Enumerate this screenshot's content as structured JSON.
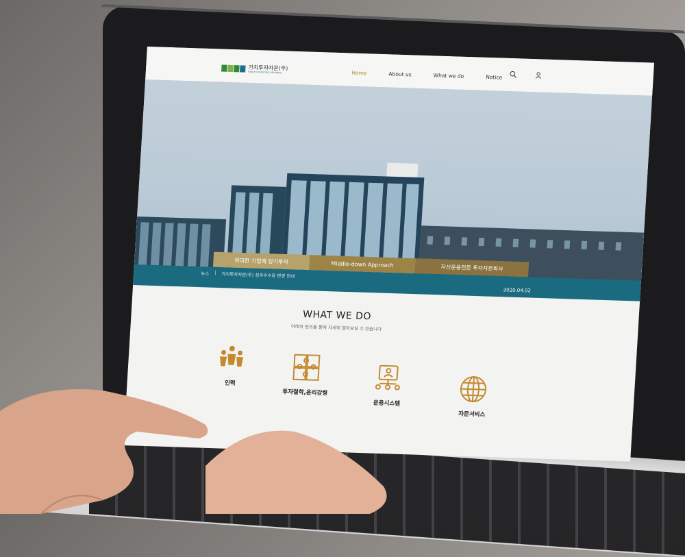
{
  "header": {
    "logo_ko": "가치투자자문(주)",
    "logo_en": "Value Investing Advisors",
    "logo_colors": [
      "#2f8a3c",
      "#7cb342",
      "#2f8a3c",
      "#1d6f8a"
    ],
    "nav": [
      {
        "label": "Home",
        "active": true
      },
      {
        "label": "About us",
        "active": false
      },
      {
        "label": "What we do",
        "active": false
      },
      {
        "label": "Notice",
        "active": false
      }
    ],
    "icons": [
      "search-icon",
      "user-icon"
    ],
    "accent": "#b38a3c"
  },
  "hero": {
    "slogans": [
      "위대한 기업에 장기투자",
      "Middle-down Approach",
      "자산운용전문 투자자문회사"
    ],
    "news_label": "뉴스",
    "news_sep": "|",
    "news_title": "가치투자자문(주) 성과수수료 변경 안내",
    "news_date": "2020.04.02",
    "bar_color": "#1b6b80"
  },
  "what_we_do": {
    "title": "WHAT WE DO",
    "subtitle": "아래의 링크를 통해 자세히 알아보실 수 있습니다",
    "items": [
      {
        "label": "인력",
        "icon": "people-icon"
      },
      {
        "label": "투자철학,윤리강령",
        "icon": "puzzle-icon"
      },
      {
        "label": "운용시스템",
        "icon": "network-icon"
      },
      {
        "label": "자문서비스",
        "icon": "globe-icon"
      }
    ]
  }
}
